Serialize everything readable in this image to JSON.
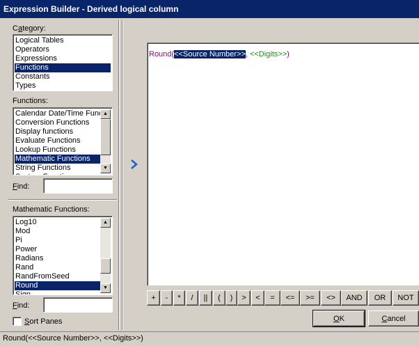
{
  "window": {
    "title": "Expression Builder - Derived logical column"
  },
  "category": {
    "label_pre": "C",
    "label_ul": "a",
    "label_post": "tegory:",
    "items": [
      "Logical Tables",
      "Operators",
      "Expressions",
      "Functions",
      "Constants",
      "Types"
    ],
    "selected": "Functions"
  },
  "functions": {
    "label": "Functions:",
    "items": [
      "Calendar Date/Time Functions",
      "Conversion Functions",
      "Display functions",
      "Evaluate Functions",
      "Lookup Functions",
      "Mathematic Functions",
      "String Functions",
      "System Functions"
    ],
    "selected": "Mathematic Functions",
    "find_label_ul": "F",
    "find_label_post": "ind:",
    "find_value": ""
  },
  "math_functions": {
    "label": "Mathematic Functions:",
    "items": [
      "Log10",
      "Mod",
      "Pi",
      "Power",
      "Radians",
      "Rand",
      "RandFromSeed",
      "Round",
      "Sign"
    ],
    "selected": "Round",
    "find_label_ul": "F",
    "find_label_post": "ind:",
    "find_value": ""
  },
  "sort_panes": {
    "label_ul": "S",
    "label_post": "ort Panes",
    "checked": false
  },
  "editor": {
    "func": "Round(",
    "selected_arg": "<<Source Number>>",
    "sep": ", ",
    "arg2": "<<Digits>>",
    "close": ")"
  },
  "operators": [
    "+",
    "-",
    "*",
    "/",
    "||",
    "(",
    ")",
    ">",
    "<",
    "=",
    "<=",
    ">=",
    "<>",
    "AND",
    "OR",
    "NOT"
  ],
  "ok_button": {
    "ul": "O",
    "post": "K"
  },
  "cancel_button": {
    "ul": "C",
    "post": "ancel"
  },
  "status": {
    "text": "Round(<<Source Number>>, <<Digits>>)"
  },
  "colors": {
    "selection": "#0a246a",
    "function": "#8b008b",
    "argument": "#1a8a1a",
    "face": "#d4d0c8"
  },
  "icons": {
    "insert": "chevron-right-icon"
  }
}
